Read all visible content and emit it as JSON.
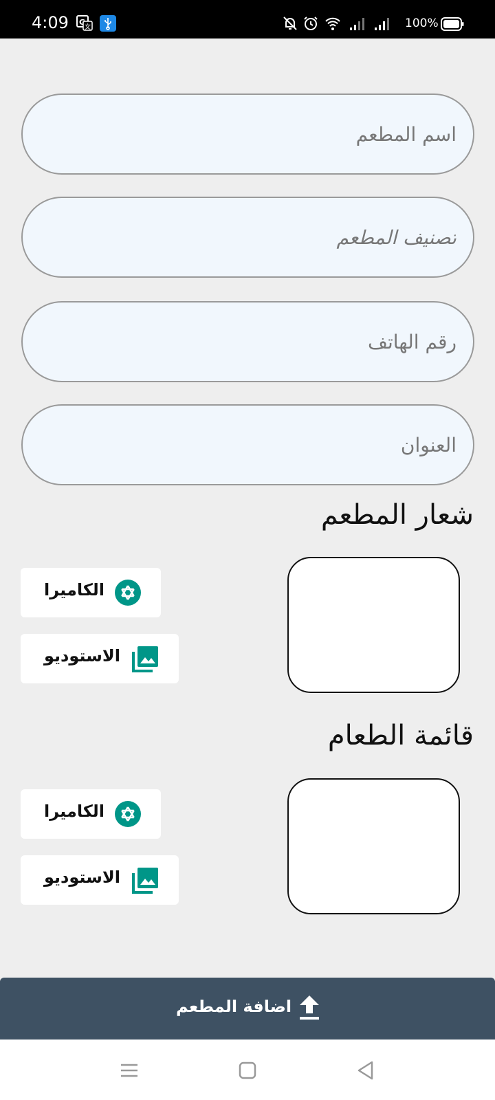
{
  "status_bar": {
    "time": "4:09",
    "battery": "100%",
    "icons": [
      "translate-icon",
      "usb-icon",
      "bell-off-icon",
      "alarm-icon",
      "wifi-icon",
      "signal-icon",
      "signal-icon",
      "battery-icon"
    ]
  },
  "form": {
    "restaurant_name_placeholder": "اسم المطعم",
    "restaurant_category_placeholder": "تصنيف المطعم",
    "phone_placeholder": "رقم الهاتف",
    "address_placeholder": "العنوان"
  },
  "logo_section": {
    "title": "شعار المطعم",
    "camera_label": "الكاميرا",
    "studio_label": "الاستوديو"
  },
  "menu_section": {
    "title": "قائمة الطعام",
    "camera_label": "الكاميرا",
    "studio_label": "الاستوديو"
  },
  "submit": {
    "label": "اضافة المطعم",
    "icon": "upload-icon"
  },
  "colors": {
    "accent": "#009688",
    "submit_bg": "#3e5163",
    "field_bg": "#f1f7fd"
  }
}
